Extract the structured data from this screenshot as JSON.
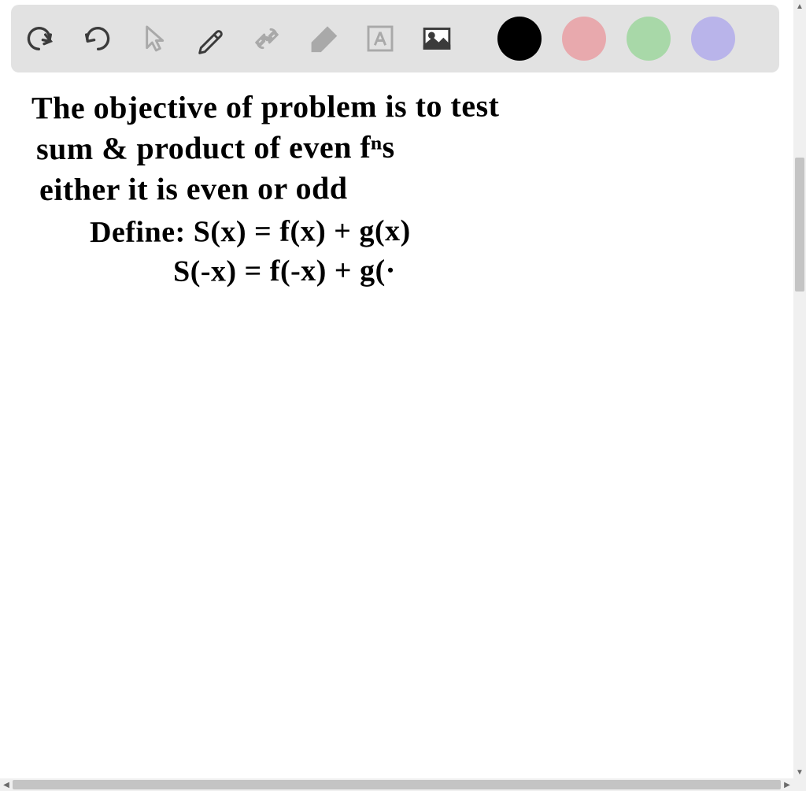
{
  "toolbar": {
    "undo": "undo",
    "redo": "redo",
    "pointer": "pointer",
    "pencil": "pencil",
    "tools": "tools",
    "eraser": "eraser",
    "text": "text",
    "image": "image"
  },
  "colors": {
    "black": "#000000",
    "pink": "#e8a9ad",
    "green": "#a8d8a8",
    "purple": "#b9b4ea"
  },
  "icon_colors": {
    "active": "#3b3b3b",
    "inactive": "#a9a9a9"
  },
  "handwriting": {
    "line1": "The objective of problem is to test",
    "line2": "sum & product of even fⁿs",
    "line3": "either it is even or odd",
    "line4": "Define: S(x) = f(x) + g(x)",
    "line5": "S(-x) = f(-x) + g(·"
  },
  "scroll": {
    "up": "▲",
    "down": "▼",
    "left": "◀",
    "right": "▶"
  }
}
